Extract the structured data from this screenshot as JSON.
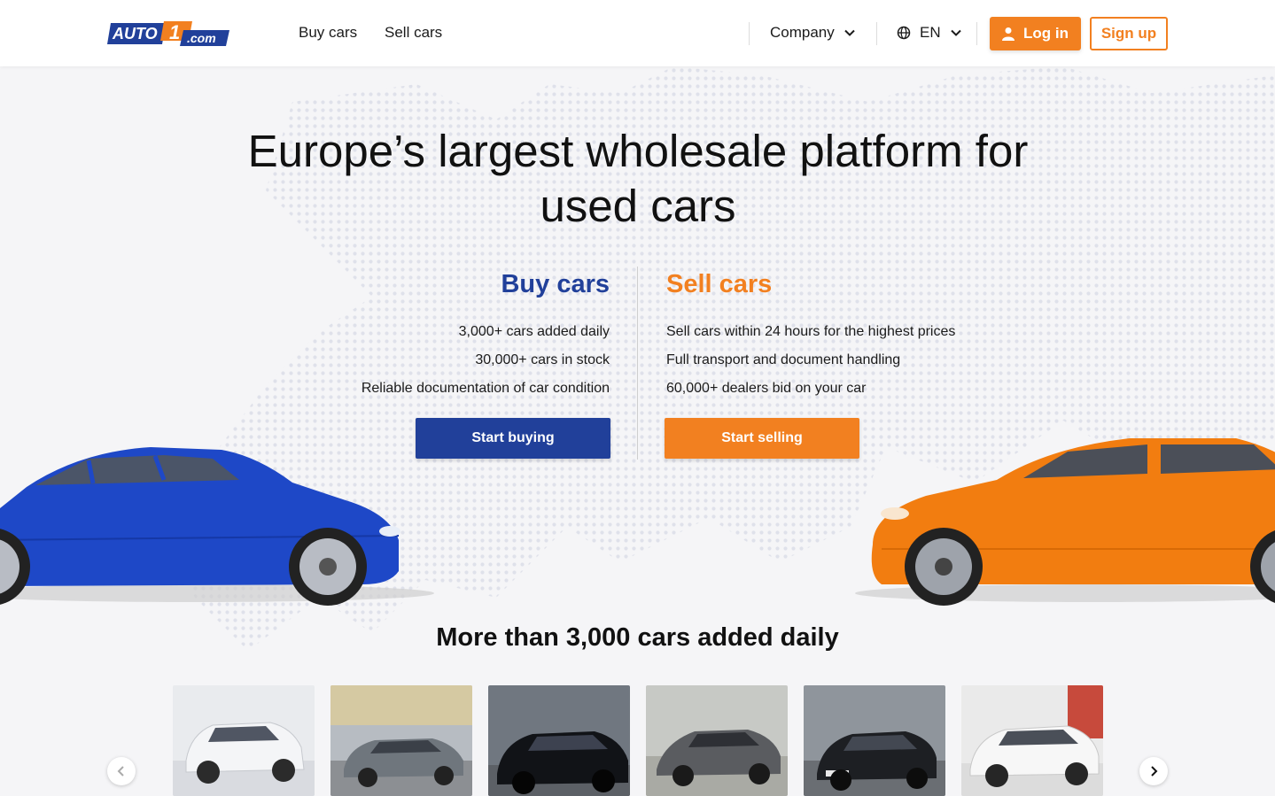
{
  "brand": {
    "logo_text": "AUTO1.com",
    "primary_color": "#21409a",
    "accent_color": "#f28020"
  },
  "nav": {
    "buy_cars": "Buy cars",
    "sell_cars": "Sell cars",
    "company": "Company",
    "language": "EN"
  },
  "auth": {
    "login": "Log in",
    "signup": "Sign up"
  },
  "hero": {
    "title": "Europe’s largest wholesale platform for used cars"
  },
  "buy": {
    "title": "Buy cars",
    "features": [
      "3,000+ cars added daily",
      "30,000+ cars in stock",
      "Reliable documentation of car condition"
    ],
    "cta": "Start buying"
  },
  "sell": {
    "title": "Sell cars",
    "features": [
      "Sell cars within 24 hours for the highest prices",
      "Full transport and document handling",
      "60,000+ dealers bid on your car"
    ],
    "cta": "Start selling"
  },
  "carousel": {
    "title": "More than 3,000 cars added daily",
    "items": [
      {
        "icon": "white-suv-photo"
      },
      {
        "icon": "gray-sedan-photo"
      },
      {
        "icon": "black-sedan-photo"
      },
      {
        "icon": "gray-coupe-photo"
      },
      {
        "icon": "black-hatchback-photo"
      },
      {
        "icon": "white-suv-photo"
      }
    ]
  }
}
